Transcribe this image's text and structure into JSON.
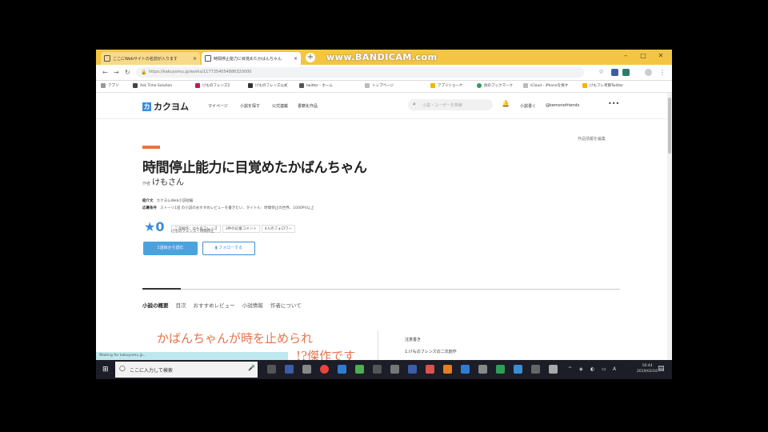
{
  "browser": {
    "tabs": [
      {
        "label": "ここにWebサイトの名前が入ります"
      },
      {
        "label": "時間停止能力に目覚めたかばんちゃん"
      }
    ],
    "watermark": "www.BANDICAM.com",
    "url": "https://kakuyomu.jp/works/1177354054886320000",
    "bookmarks": [
      "アプリ",
      "Ask Time Solution",
      "けものフレンズ2",
      "けものフレンズ公式",
      "twitter - ホーム",
      "トップページ",
      "アプリショーケ",
      "他のブックマーク",
      "iCloud - iPhoneを探す",
      "けもフレ考察Twitter"
    ]
  },
  "site": {
    "logo": "カクヨム",
    "nav": [
      "マイページ",
      "小説を探す",
      "公式連載",
      "書籍化作品"
    ],
    "search_placeholder": "小説・ユーザーを検索",
    "write_link": "小説書く",
    "user_name": "@kemonofriends",
    "report_link": "作品情報を編集"
  },
  "work": {
    "title": "時間停止能力に目覚めたかばんちゃん",
    "author_label": "作者",
    "author": "けもさん",
    "meta": [
      {
        "label": "紹介文",
        "value": "カクヨムWeb小説短編"
      },
      {
        "label": "応募条件",
        "value": "ストーリ1話 の小説のおすすめレビューを書きたい、タイトル：時間停止の世界、1000PV以上"
      }
    ],
    "rating": "★0",
    "tags": [
      "二次創作：けものフレンズ",
      "3件の応援コメント",
      "4人のフォロワー"
    ],
    "tag_line2": "けものフレンズ・時間停止",
    "read_button": "1話目から読む",
    "follow_button": "フォローする"
  },
  "content_tabs": [
    "小説の概要",
    "目次",
    "おすすめレビュー",
    "小説情報",
    "作者について"
  ],
  "catchcopy": {
    "line1": "かばんちゃんが時を止められ",
    "line2": "!?傑作です"
  },
  "side": {
    "heading": "注意書き",
    "item": "1.けものフレンズの二次創作"
  },
  "status_text": "Waiting for kakuyomu.jp...",
  "taskbar": {
    "search_placeholder": "ここに入力して検索",
    "time": "16:44",
    "date": "2019/02/16"
  },
  "colors": {
    "accent": "#3a8ed8",
    "highlight": "#e8734a",
    "tabstrip": "#f4c542"
  }
}
